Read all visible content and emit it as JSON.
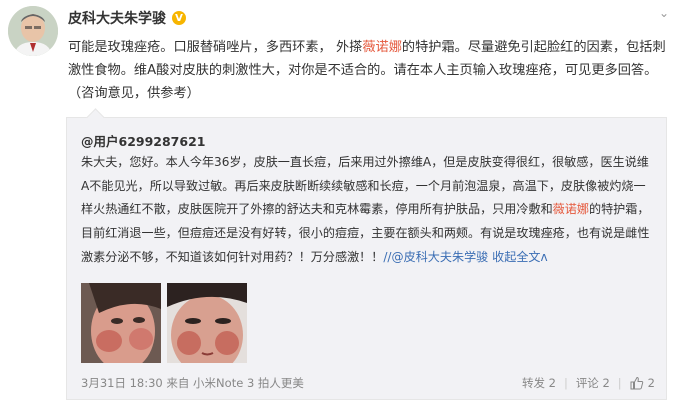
{
  "post": {
    "author": "皮科大夫朱学骏",
    "badge": "V",
    "text": [
      {
        "t": "可能是玫瑰痤疮。口服替硝唑片，多西环素， 外搽"
      },
      {
        "t": "薇诺娜",
        "hl": true
      },
      {
        "t": "的特护霜。尽量避免引起脸红的因素，包括刺激性食物。维A酸对皮肤的刺激性大，对你是不适合的。请在本人主页输入玫瑰痤疮，可见更多回答。（咨询意见，供参考）"
      }
    ]
  },
  "repost": {
    "author": "@用户6299287621",
    "text": [
      {
        "t": "朱大夫，您好。本人今年36岁，皮肤一直长痘，后来用过外擦维A，但是皮肤变得很红，很敏感，医生说维A不能见光，所以导致过敏。再后来皮肤断断续续敏感和长痘，一个月前泡温泉，高温下，皮肤像被灼烧一样火热通红不散，皮肤医院开了外擦的舒达夫和克林霉素，停用所有护肤品，只用冷敷和"
      },
      {
        "t": "薇诺娜",
        "hl": true
      },
      {
        "t": "的特护霜，目前红消退一些，但痘痘还是没有好转，很小的痘痘，主要在额头和两颊。有说是玫瑰痤疮，也有说是雌性激素分泌不够，不知道该如何针对用药？！万分感激！！"
      },
      {
        "t": "//@皮科大夫朱学骏",
        "link": true
      },
      {
        "t": "  "
      },
      {
        "t": "收起全文",
        "link": true
      },
      {
        "t": "ʌ",
        "link": true
      }
    ],
    "footer": {
      "time": "3月31日 18:30",
      "source": "来自 小米Note 3 拍人更美",
      "repost_label": "转发 2",
      "comment_label": "评论 2",
      "like_count": "2"
    }
  }
}
